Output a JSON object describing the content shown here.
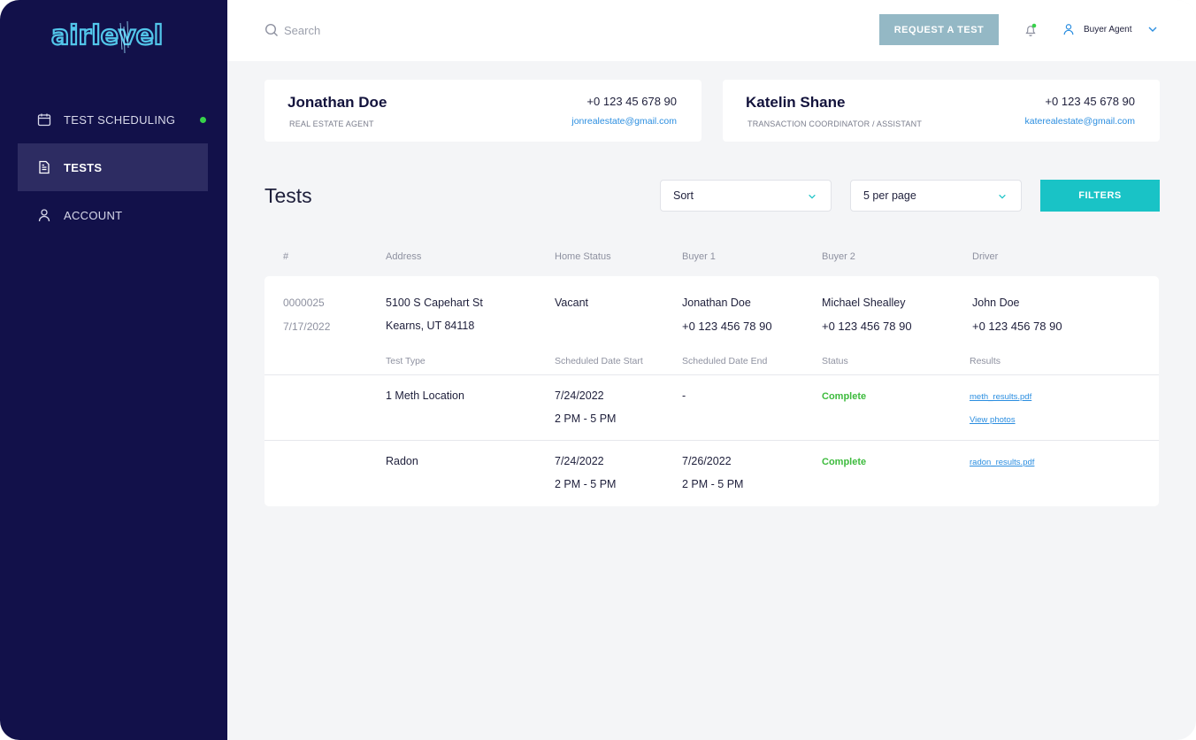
{
  "brand": {
    "logo_text": "airlevel"
  },
  "sidebar": {
    "items": [
      {
        "label": "TEST SCHEDULING",
        "icon": "calendar-icon"
      },
      {
        "label": "TESTS",
        "icon": "document-icon"
      },
      {
        "label": "ACCOUNT",
        "icon": "user-icon"
      }
    ]
  },
  "topbar": {
    "search_placeholder": "Search",
    "request_label": "REQUEST A TEST",
    "user_label": "Buyer Agent"
  },
  "contacts": [
    {
      "name": "Jonathan Doe",
      "role": "REAL ESTATE AGENT",
      "phone": "+0 123 45 678 90",
      "email": "jonrealestate@gmail.com"
    },
    {
      "name": "Katelin Shane",
      "role": "TRANSACTION COORDINATOR / ASSISTANT",
      "phone": "+0 123 45 678 90",
      "email": "katerealestate@gmail.com"
    }
  ],
  "tests": {
    "title": "Tests",
    "sort_label": "Sort",
    "per_page_label": "5 per page",
    "filters_label": "FILTERS",
    "columns": [
      "#",
      "Address",
      "Home Status",
      "Buyer 1",
      "Buyer 2",
      "Driver"
    ],
    "sub_columns": [
      "Test Type",
      "Scheduled Date Start",
      "Scheduled Date End",
      "Status",
      "Results"
    ],
    "record": {
      "id": "0000025",
      "date": "7/17/2022",
      "address_line1": "5100 S Capehart St",
      "address_line2": "Kearns, UT 84118",
      "home_status": "Vacant",
      "buyer1_name": "Jonathan Doe",
      "buyer1_phone": "+0 123 456 78 90",
      "buyer2_name": "Michael Shealley",
      "buyer2_phone": "+0 123 456 78 90",
      "driver_name": "John Doe",
      "driver_phone": "+0 123 456 78 90"
    },
    "rows": [
      {
        "type": "1 Meth Location",
        "start_date": "7/24/2022",
        "start_time": "2 PM - 5 PM",
        "end_date": "-",
        "end_time": "",
        "status": "Complete",
        "result_link": "meth_results.pdf",
        "extra_link": "View photos"
      },
      {
        "type": "Radon",
        "start_date": "7/24/2022",
        "start_time": "2 PM - 5 PM",
        "end_date": "7/26/2022",
        "end_time": "2 PM - 5 PM",
        "status": "Complete",
        "result_link": "radon_results.pdf",
        "extra_link": ""
      }
    ]
  },
  "colors": {
    "sidebar": "#12114a",
    "accent": "#19c3c6",
    "request_button": "#94b8c5",
    "success": "#3dbb3d",
    "link": "#2b8ee0"
  }
}
